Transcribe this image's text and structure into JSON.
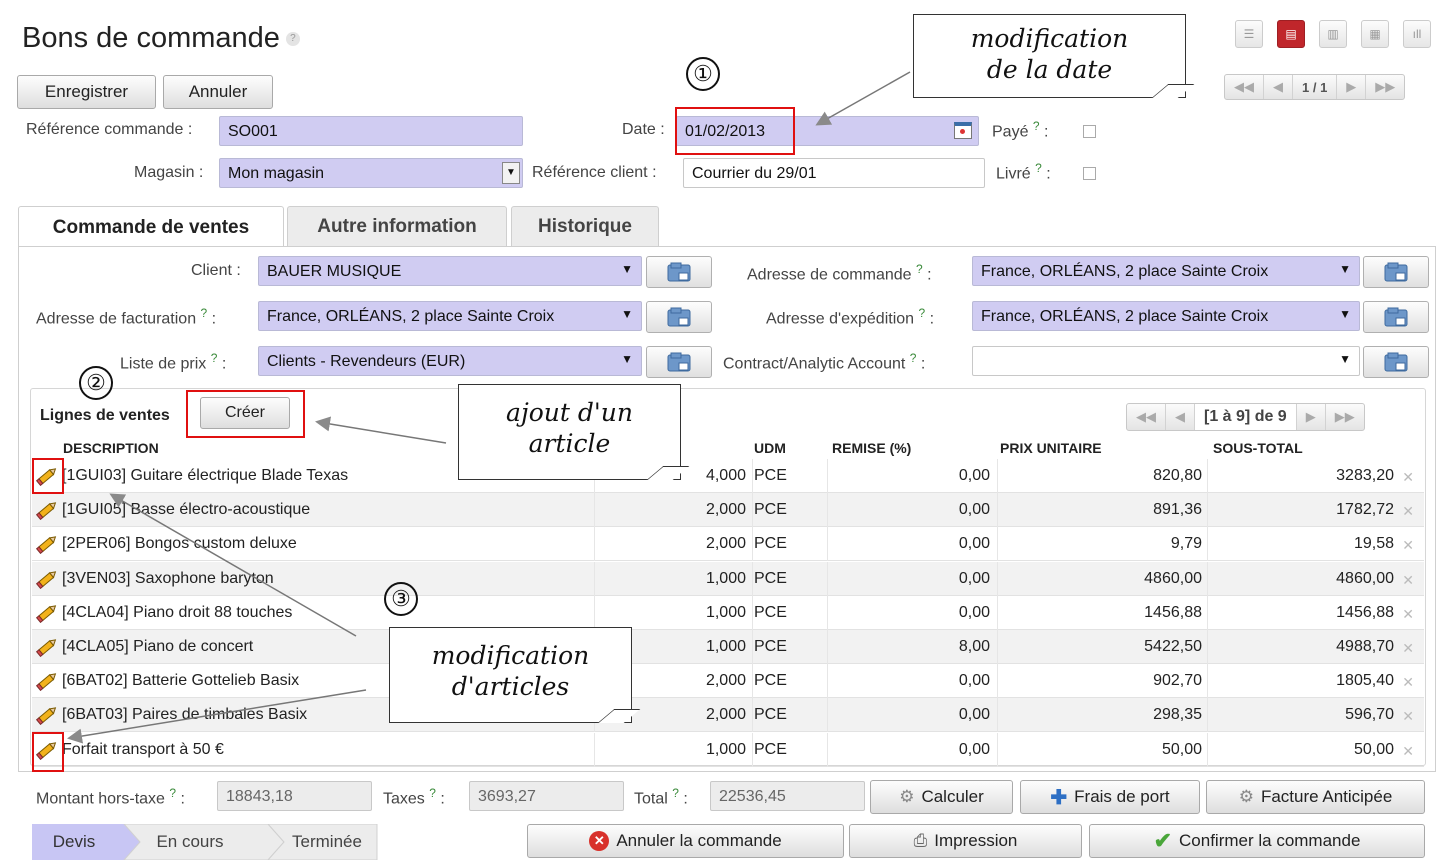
{
  "page": {
    "title": "Bons de commande"
  },
  "toolbar": {
    "save": "Enregistrer",
    "cancel": "Annuler",
    "pager": "1 / 1"
  },
  "header": {
    "ref_label": "Référence commande :",
    "ref_value": "SO001",
    "date_label": "Date :",
    "date_value": "01/02/2013",
    "paid_label": "Payé",
    "delivered_label": "Livré",
    "shop_label": "Magasin :",
    "shop_value": "Mon magasin",
    "client_ref_label": "Référence client :",
    "client_ref_value": "Courrier du 29/01"
  },
  "tabs": [
    "Commande de ventes",
    "Autre information",
    "Historique"
  ],
  "form": {
    "client_label": "Client :",
    "client_value": "BAUER MUSIQUE",
    "order_addr_label": "Adresse de commande",
    "order_addr_value": "France, ORLÉANS, 2 place Sainte Croix",
    "invoice_addr_label": "Adresse de facturation",
    "invoice_addr_value": "France, ORLÉANS, 2 place Sainte Croix",
    "ship_addr_label": "Adresse d'expédition",
    "ship_addr_value": "France, ORLÉANS, 2 place Sainte Croix",
    "pricelist_label": "Liste de prix",
    "pricelist_value": "Clients - Revendeurs (EUR)",
    "analytic_label": "Contract/Analytic Account",
    "analytic_value": ""
  },
  "lines": {
    "title": "Lignes de ventes",
    "create": "Créer",
    "pager": "[1 à 9] de 9",
    "columns": [
      "DESCRIPTION",
      "UDM",
      "REMISE (%)",
      "PRIX UNITAIRE",
      "SOUS-TOTAL"
    ],
    "rows": [
      {
        "desc": "[1GUI03] Guitare électrique Blade Texas",
        "qty": "4,000",
        "udm": "PCE",
        "disc": "0,00",
        "price": "820,80",
        "subtotal": "3283,20"
      },
      {
        "desc": "[1GUI05] Basse électro-acoustique",
        "qty": "2,000",
        "udm": "PCE",
        "disc": "0,00",
        "price": "891,36",
        "subtotal": "1782,72"
      },
      {
        "desc": "[2PER06] Bongos custom deluxe",
        "qty": "2,000",
        "udm": "PCE",
        "disc": "0,00",
        "price": "9,79",
        "subtotal": "19,58"
      },
      {
        "desc": "[3VEN03] Saxophone baryton",
        "qty": "1,000",
        "udm": "PCE",
        "disc": "0,00",
        "price": "4860,00",
        "subtotal": "4860,00"
      },
      {
        "desc": "[4CLA04] Piano droit 88 touches",
        "qty": "1,000",
        "udm": "PCE",
        "disc": "0,00",
        "price": "1456,88",
        "subtotal": "1456,88"
      },
      {
        "desc": "[4CLA05] Piano de concert",
        "qty": "1,000",
        "udm": "PCE",
        "disc": "8,00",
        "price": "5422,50",
        "subtotal": "4988,70"
      },
      {
        "desc": "[6BAT02] Batterie Gottelieb Basix",
        "qty": "2,000",
        "udm": "PCE",
        "disc": "0,00",
        "price": "902,70",
        "subtotal": "1805,40"
      },
      {
        "desc": "[6BAT03] Paires de timbales Basix",
        "qty": "2,000",
        "udm": "PCE",
        "disc": "0,00",
        "price": "298,35",
        "subtotal": "596,70"
      },
      {
        "desc": "Forfait transport à 50 €",
        "qty": "1,000",
        "udm": "PCE",
        "disc": "0,00",
        "price": "50,00",
        "subtotal": "50,00"
      }
    ]
  },
  "totals": {
    "untaxed_label": "Montant hors-taxe",
    "untaxed_value": "18843,18",
    "taxes_label": "Taxes",
    "taxes_value": "3693,27",
    "total_label": "Total",
    "total_value": "22536,45",
    "compute": "Calculer",
    "shipping": "Frais de port",
    "advance_invoice": "Facture Anticipée"
  },
  "states": [
    "Devis",
    "En cours",
    "Terminée"
  ],
  "actions": {
    "cancel_order": "Annuler la commande",
    "print": "Impression",
    "confirm": "Confirmer la commande"
  },
  "annotations": {
    "n1": "①",
    "n2": "②",
    "n3": "③",
    "note_date_1": "modification",
    "note_date_2": "de la date",
    "note_add_1": "ajout d'un",
    "note_add_2": "article",
    "note_edit_1": "modification",
    "note_edit_2": "d'articles"
  },
  "colors": {
    "accent_red": "#c0262b",
    "field_purple": "#d0ccf2",
    "state_active": "#c8c6f4"
  }
}
